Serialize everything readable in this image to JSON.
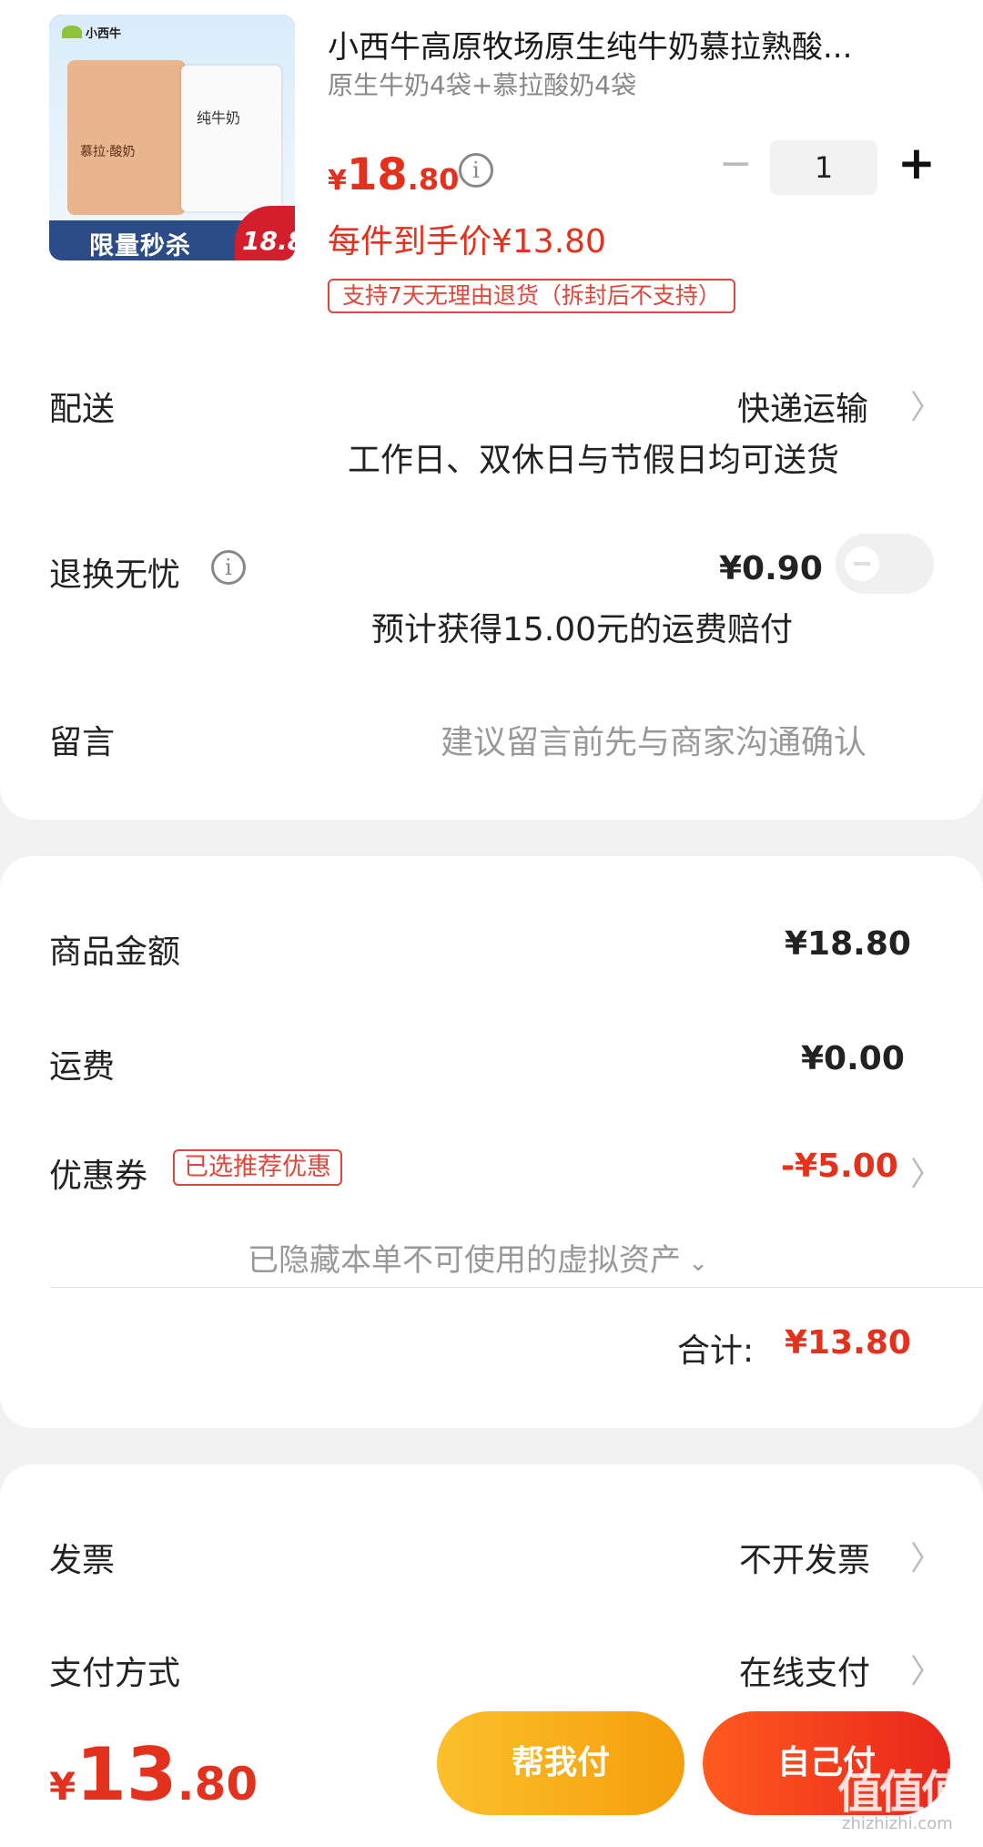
{
  "product": {
    "thumb_band_text": "限量秒杀",
    "thumb_price_badge": "18.8",
    "thumb_bag_left": "慕拉·酸奶",
    "thumb_bag_right": "纯牛奶",
    "thumb_logo": "小西牛",
    "title": "小西牛高原牧场原生纯牛奶慕拉熟酸...",
    "spec": "原生牛奶4袋+慕拉酸奶4袋",
    "price_currency": "¥",
    "price_integer": "18",
    "price_decimal": ".80",
    "info_icon": "i",
    "quantity": "1",
    "minus_symbol": "−",
    "plus_symbol": "+",
    "unit_price": "每件到手价¥13.80",
    "return_policy": "支持7天无理由退货（拆封后不支持）"
  },
  "delivery": {
    "label": "配送",
    "method": "快递运输",
    "note": "工作日、双休日与节假日均可送货"
  },
  "return_insurance": {
    "label": "退换无忧",
    "price": "¥0.90",
    "note": "预计获得15.00元的运费赔付",
    "enabled": false
  },
  "message": {
    "label": "留言",
    "placeholder": "建议留言前先与商家沟通确认"
  },
  "summary": {
    "goods_label": "商品金额",
    "goods_value": "¥18.80",
    "shipping_label": "运费",
    "shipping_value": "¥0.00",
    "coupon_label": "优惠券",
    "coupon_tag": "已选推荐优惠",
    "coupon_value": "-¥5.00",
    "hidden_assets": "已隐藏本单不可使用的虚拟资产",
    "total_label": "合计:",
    "total_value": "¥13.80"
  },
  "invoice": {
    "label": "发票",
    "value": "不开发票"
  },
  "payment": {
    "label": "支付方式",
    "value": "在线支付"
  },
  "bottom_bar": {
    "currency": "¥",
    "amount_integer": "13",
    "amount_decimal": ".80",
    "help_pay_label": "帮我付",
    "self_pay_label": "自己付"
  },
  "watermark": {
    "text": "值值值",
    "url": "zhizhizhi.com"
  },
  "colors": {
    "accent_red": "#e3311d",
    "yellow_button": "#fbc02d",
    "red_button": "#ff5a1f"
  }
}
